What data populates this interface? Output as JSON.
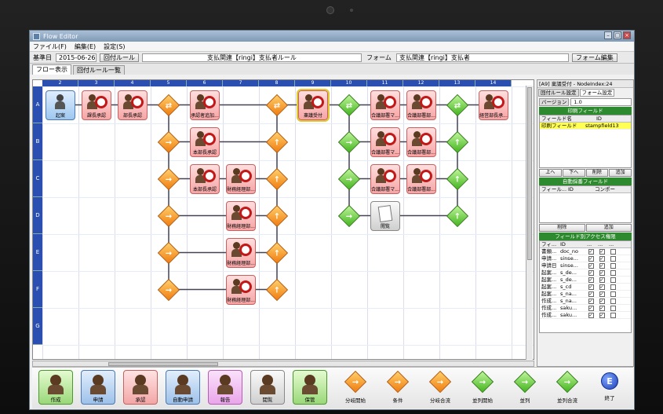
{
  "window": {
    "title": "Flow Editor"
  },
  "menu": [
    "ファイル(F)",
    "編集(E)",
    "設定(S)"
  ],
  "infobar": {
    "date_label": "基準日",
    "date_value": "2015-06-26",
    "rule_button": "回付ルール",
    "rule_name": "支払関連【ringi】支払者ルール",
    "form_label": "フォーム",
    "form_value": "支払関連【ringi】支払者",
    "form_button": "フォーム編集"
  },
  "tabs": [
    "フロー表示",
    "回付ルール一覧"
  ],
  "grid": {
    "columns": [
      "2",
      "3",
      "4",
      "5",
      "6",
      "7",
      "8",
      "9",
      "10",
      "11",
      "12",
      "13",
      "14"
    ],
    "rows": [
      "A",
      "B",
      "C",
      "D",
      "E",
      "F",
      "G"
    ]
  },
  "nodes": [
    {
      "label": "起案",
      "kind": "blue"
    },
    {
      "label": "課長承認",
      "kind": "red"
    },
    {
      "label": "部長承認",
      "kind": "red"
    },
    {
      "label": "承認者追加...",
      "kind": "red"
    },
    {
      "label": "本部長承認",
      "kind": "red"
    },
    {
      "label": "本部長承認",
      "kind": "red"
    },
    {
      "label": "財務経理部...",
      "kind": "red"
    },
    {
      "label": "財務経理部...",
      "kind": "red"
    },
    {
      "label": "財務経理部...",
      "kind": "red"
    },
    {
      "label": "財務経理部...",
      "kind": "red"
    },
    {
      "label": "稟議受付",
      "kind": "red"
    },
    {
      "label": "合議部署マ...",
      "kind": "red"
    },
    {
      "label": "合議部署部...",
      "kind": "red"
    },
    {
      "label": "合議部署マ...",
      "kind": "red"
    },
    {
      "label": "合議部署部...",
      "kind": "red"
    },
    {
      "label": "合議部署マ...",
      "kind": "red"
    },
    {
      "label": "合議部署部...",
      "kind": "red"
    },
    {
      "label": "閲覧",
      "kind": "gray"
    },
    {
      "label": "経営部長承...",
      "kind": "red"
    }
  ],
  "right_panel": {
    "title": "[A9] 稟議受付 - NodeIndex:24",
    "tabs": [
      "回付ルール設定",
      "フォーム設定"
    ],
    "version_label": "バージョン",
    "version_value": "1.0",
    "print_section": "印刷フィールド",
    "print_headers": [
      "フィールド名",
      "ID"
    ],
    "print_rows": [
      [
        "印刷フィールド",
        "stampfield13"
      ]
    ],
    "buttons1": [
      "上へ",
      "下へ",
      "削除",
      "追加"
    ],
    "auto_section": "自動採番フィールド",
    "auto_headers": [
      "フィール...",
      "ID",
      "コンポー"
    ],
    "buttons2": [
      "削除",
      "追加"
    ],
    "access_section": "フィールド別アクセス権限",
    "access_headers": [
      "フィ...",
      "ID",
      "...",
      "...",
      "..."
    ],
    "access_rows": [
      [
        "書類...",
        "doc_no"
      ],
      [
        "申請...",
        "sinse..."
      ],
      [
        "申請日",
        "sinse..."
      ],
      [
        "起案...",
        "s_de..."
      ],
      [
        "起案...",
        "s_de..."
      ],
      [
        "起案...",
        "s_cd"
      ],
      [
        "起案...",
        "s_na..."
      ],
      [
        "作成...",
        "s_na..."
      ],
      [
        "作成...",
        "saku..."
      ],
      [
        "作成...",
        "saku..."
      ]
    ]
  },
  "toolbar": {
    "items": [
      {
        "label": "作成",
        "kind": "green"
      },
      {
        "label": "申請",
        "kind": "blue"
      },
      {
        "label": "承認",
        "kind": "red"
      },
      {
        "label": "自動申請",
        "kind": "blue"
      },
      {
        "label": "報告",
        "kind": "pink"
      },
      {
        "label": "閲覧",
        "kind": "gray"
      },
      {
        "label": "保管",
        "kind": "green"
      }
    ],
    "diamonds": [
      {
        "label": "分岐開始",
        "kind": "o"
      },
      {
        "label": "条件",
        "kind": "o"
      },
      {
        "label": "分岐合流",
        "kind": "o"
      },
      {
        "label": "並列開始",
        "kind": "g"
      },
      {
        "label": "並列",
        "kind": "g"
      },
      {
        "label": "並列合流",
        "kind": "g"
      }
    ],
    "end": {
      "label": "終了",
      "glyph": "E"
    }
  },
  "colors": {
    "accent_blue": "#2a4fb0",
    "section_green": "#2e8a2e",
    "orange": "#f07d10",
    "green": "#45b520",
    "stamp_red": "#c21818"
  }
}
